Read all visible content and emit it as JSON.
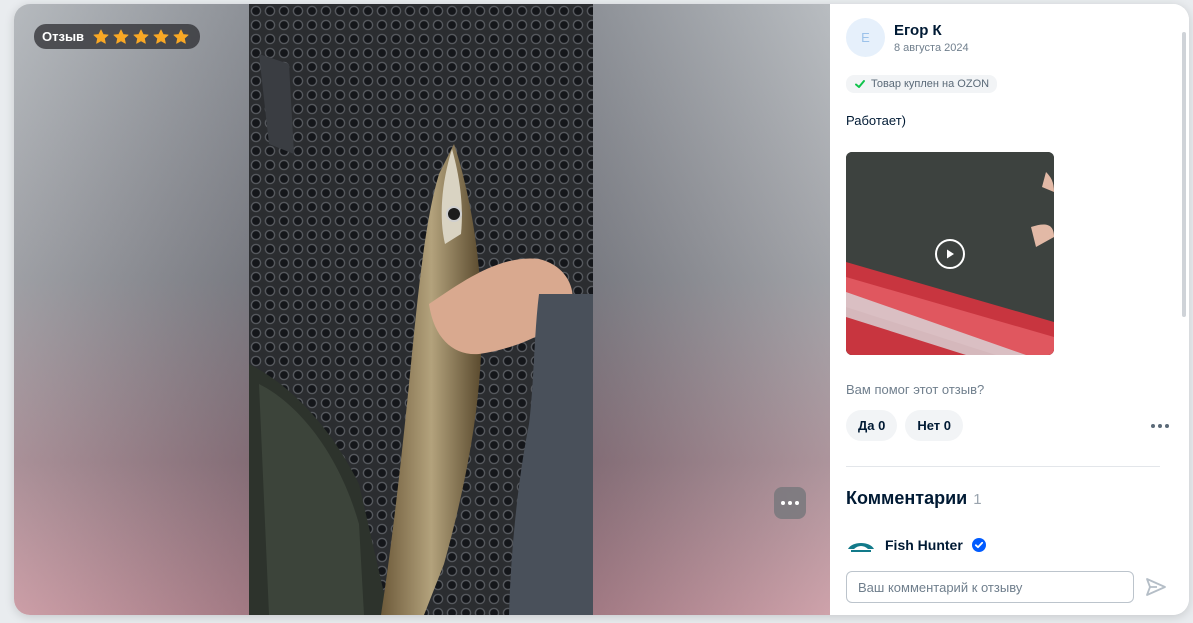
{
  "media": {
    "badge_label": "Отзыв",
    "rating": 5,
    "star_color": "#f9a825"
  },
  "review": {
    "author": {
      "initial": "Е",
      "name": "Егор К",
      "date": "8 августа 2024"
    },
    "purchase_badge": "Товар куплен на OZON",
    "text": "Работает)",
    "helpful_question": "Вам помог этот отзыв?",
    "vote_yes": "Да 0",
    "vote_no": "Нет 0"
  },
  "comments": {
    "title": "Комментарии",
    "count": "1",
    "items": [
      {
        "author": "Fish Hunter",
        "verified": true
      }
    ],
    "input_placeholder": "Ваш комментарий к отзыву"
  },
  "colors": {
    "accent": "#005bff",
    "text": "#001a34",
    "muted": "#707f8d",
    "check": "#10c44c"
  }
}
